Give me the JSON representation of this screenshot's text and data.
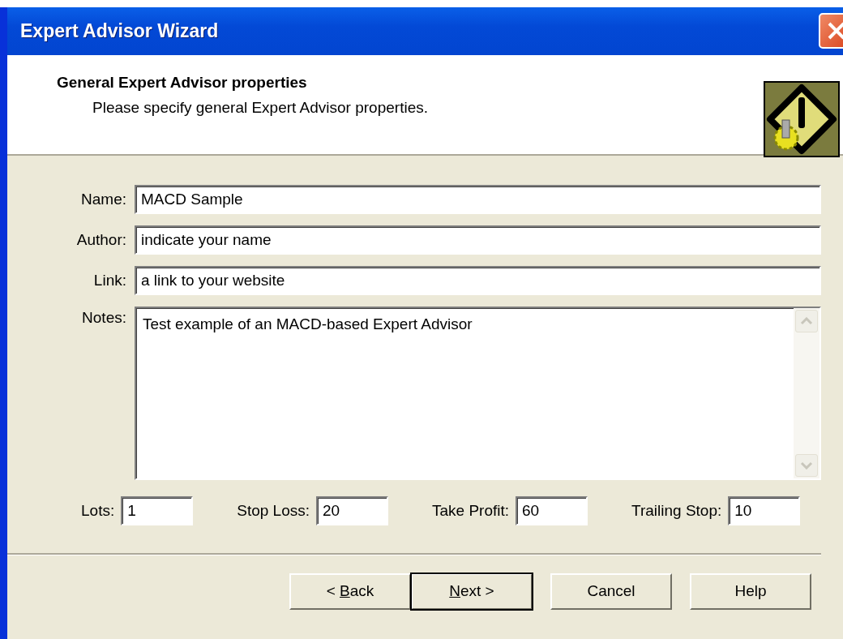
{
  "window": {
    "title": "Expert Advisor Wizard"
  },
  "header": {
    "title": "General Expert Advisor properties",
    "subtitle": "Please specify general Expert Advisor properties."
  },
  "fields": [
    {
      "label": "Name:",
      "value": "MACD Sample"
    },
    {
      "label": "Author:",
      "value": "indicate your name"
    },
    {
      "label": "Link:",
      "value": "a link to your website"
    }
  ],
  "notes": {
    "label": "Notes:",
    "value": "Test example of an MACD-based Expert Advisor"
  },
  "parameters": [
    {
      "label": "Lots:",
      "value": "1"
    },
    {
      "label": "Stop Loss:",
      "value": "20"
    },
    {
      "label": "Take Profit:",
      "value": "60"
    },
    {
      "label": "Trailing Stop:",
      "value": "10"
    }
  ],
  "buttons": [
    {
      "prefix": "< ",
      "access_key": "B",
      "suffix": "ack",
      "default": false
    },
    {
      "access_key": "N",
      "suffix": "ext >",
      "default": true
    },
    {
      "suffix": "Cancel",
      "default": false
    },
    {
      "suffix": "Help",
      "default": false
    }
  ]
}
